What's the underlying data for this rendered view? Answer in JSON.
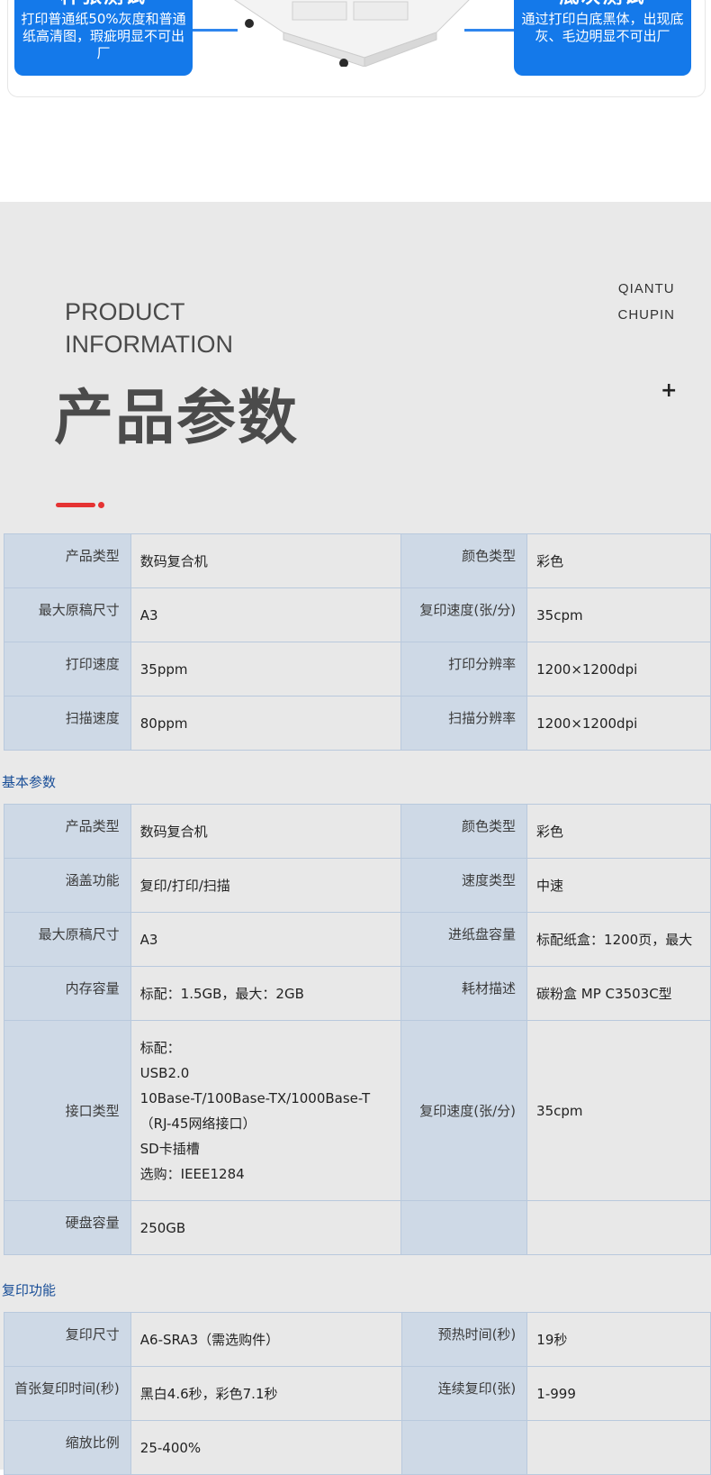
{
  "banner": {
    "left_callout": {
      "title": "样张测试",
      "desc": "打印普通纸50%灰度和普通纸高清图，瑕疵明显不可出厂"
    },
    "right_callout": {
      "title": "底灰测试",
      "desc": "通过打印白底黑体，出现底灰、毛边明显不可出厂"
    }
  },
  "header": {
    "corner_line1": "QIANTU",
    "corner_line2": "CHUPIN",
    "eng_line1": "PRODUCT",
    "eng_line2": "INFORMATION",
    "plus": "+",
    "title": "产品参数"
  },
  "summary_table": [
    {
      "k1": "产品类型",
      "v1": "数码复合机",
      "k2": "颜色类型",
      "v2": "彩色"
    },
    {
      "k1": "最大原稿尺寸",
      "v1": "A3",
      "k2": "复印速度(张/分)",
      "v2": "35cpm"
    },
    {
      "k1": "打印速度",
      "v1": "35ppm",
      "k2": "打印分辨率",
      "v2": "1200×1200dpi"
    },
    {
      "k1": "扫描速度",
      "v1": "80ppm",
      "k2": "扫描分辨率",
      "v2": "1200×1200dpi"
    }
  ],
  "basic": {
    "label": "基本参数",
    "rows": [
      {
        "k1": "产品类型",
        "v1": "数码复合机",
        "k2": "颜色类型",
        "v2": "彩色"
      },
      {
        "k1": "涵盖功能",
        "v1": "复印/打印/扫描",
        "k2": "速度类型",
        "v2": "中速"
      },
      {
        "k1": "最大原稿尺寸",
        "v1": "A3",
        "k2": "进纸盘容量",
        "v2": "标配纸盒：1200页，最大"
      },
      {
        "k1": "内存容量",
        "v1": "标配：1.5GB，最大：2GB",
        "k2": "耗材描述",
        "v2": "碳粉盒 MP C3503C型"
      }
    ],
    "interface": {
      "k1": "接口类型",
      "lines": [
        "标配：",
        "USB2.0",
        "10Base-T/100Base-TX/1000Base-T（RJ-45网络接口）",
        "SD卡插槽",
        "选购：IEEE1284"
      ],
      "k2": "复印速度(张/分)",
      "v2": "35cpm"
    },
    "disk": {
      "k1": "硬盘容量",
      "v1": "250GB",
      "k2": "",
      "v2": ""
    }
  },
  "copy": {
    "label": "复印功能",
    "rows": [
      {
        "k1": "复印尺寸",
        "v1": "A6-SRA3（需选购件）",
        "k2": "预热时间(秒)",
        "v2": "19秒"
      },
      {
        "k1": "首张复印时间(秒)",
        "v1": "黑白4.6秒，彩色7.1秒",
        "k2": "连续复印(张)",
        "v2": "1-999"
      },
      {
        "k1": "缩放比例",
        "v1": "25-400%",
        "k2": "",
        "v2": ""
      }
    ]
  },
  "colors": {
    "callout_blue": "#1479ea",
    "key_cell": "#ced9e6",
    "value_cell": "#e8e8e8",
    "border": "#b9c9dd",
    "section_text": "#1a4f98",
    "accent_red": "#e53333"
  }
}
